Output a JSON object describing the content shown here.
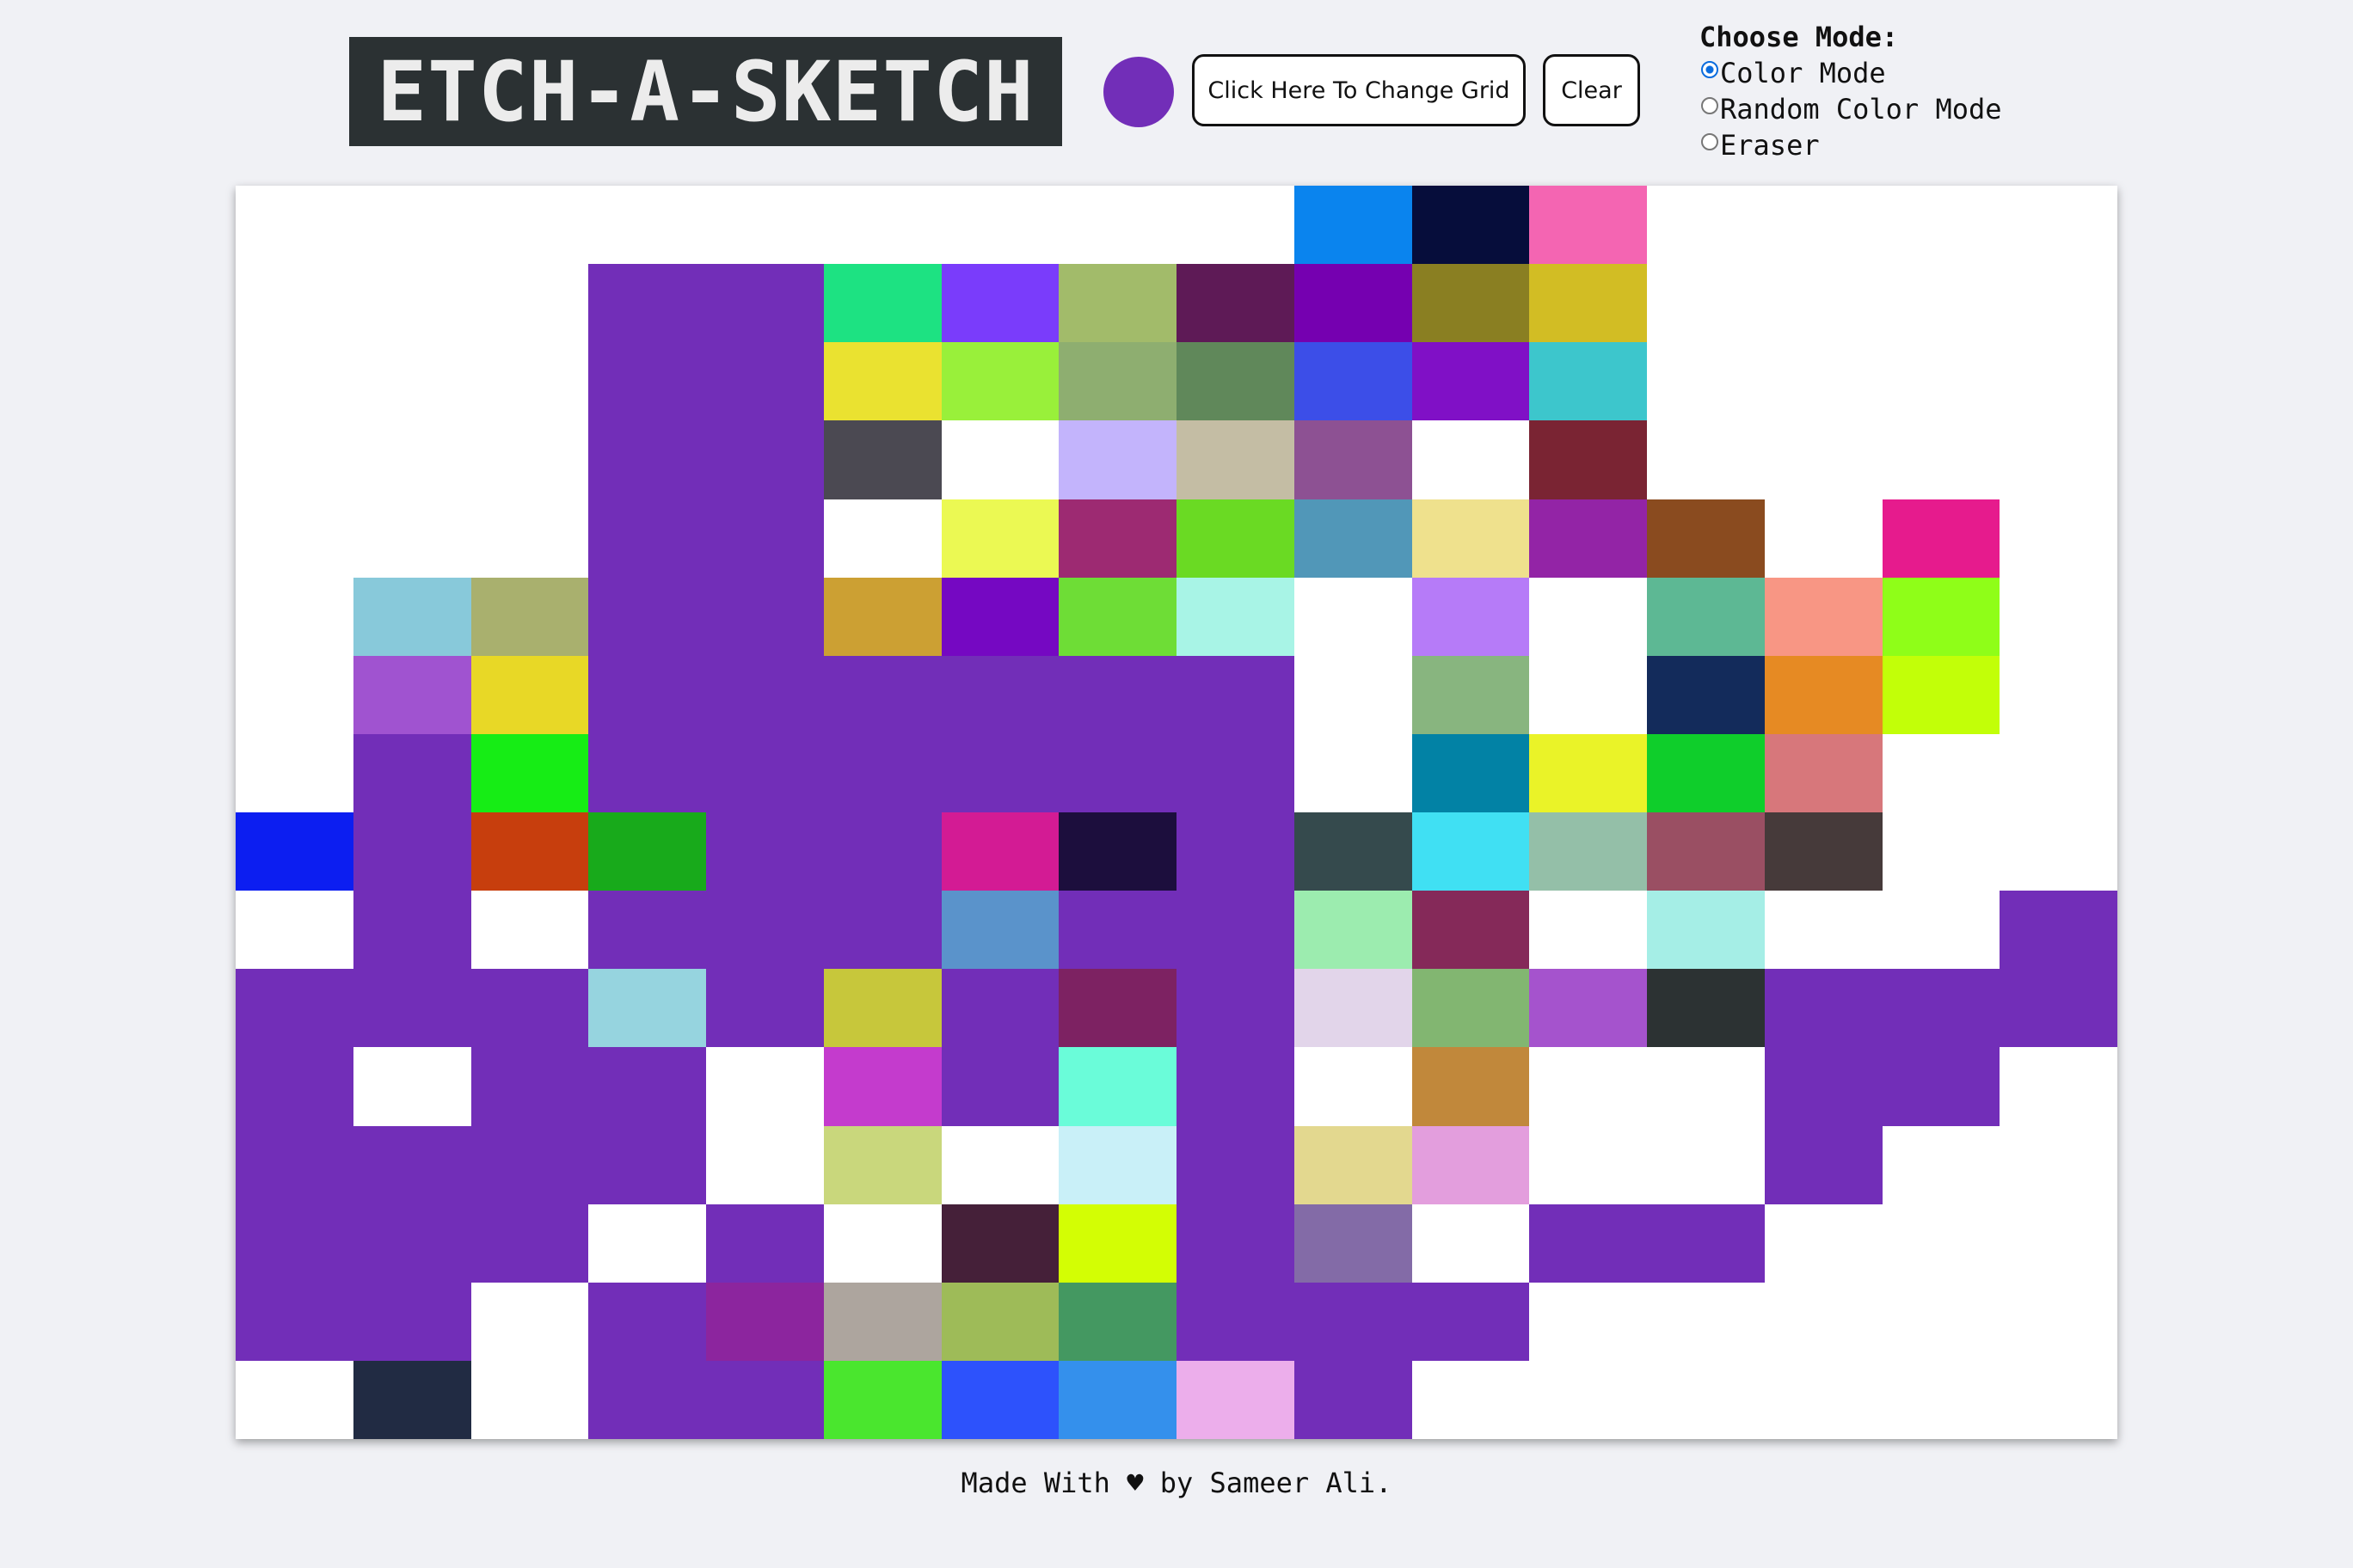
{
  "header": {
    "title": "ETCH-A-SKETCH",
    "color_picker_value": "#722eb8",
    "change_grid_label": "Click Here To Change Grid",
    "clear_label": "Clear"
  },
  "modes": {
    "heading": "Choose Mode:",
    "options": [
      {
        "label": "Color Mode",
        "checked": true
      },
      {
        "label": "Random Color Mode",
        "checked": false
      },
      {
        "label": "Eraser",
        "checked": false
      }
    ]
  },
  "grid": {
    "size": 16,
    "cells": [
      [
        "#ffffff",
        "#ffffff",
        "#ffffff",
        "#ffffff",
        "#ffffff",
        "#ffffff",
        "#ffffff",
        "#ffffff",
        "#ffffff",
        "#0a84ee",
        "#060d3b",
        "#f465b2",
        "#ffffff",
        "#ffffff",
        "#ffffff",
        "#ffffff"
      ],
      [
        "#ffffff",
        "#ffffff",
        "#ffffff",
        "#722eb8",
        "#722eb8",
        "#1de282",
        "#7a3cfb",
        "#a2bb6a",
        "#5e1a56",
        "#7500b0",
        "#8a7f22",
        "#d2bd24",
        "#ffffff",
        "#ffffff",
        "#ffffff",
        "#ffffff"
      ],
      [
        "#ffffff",
        "#ffffff",
        "#ffffff",
        "#722eb8",
        "#722eb8",
        "#eae230",
        "#99f03a",
        "#8eae70",
        "#60885a",
        "#3c4ee8",
        "#8010c6",
        "#3dc6cc",
        "#ffffff",
        "#ffffff",
        "#ffffff",
        "#ffffff"
      ],
      [
        "#ffffff",
        "#ffffff",
        "#ffffff",
        "#722eb8",
        "#722eb8",
        "#4b4952",
        "#ffffff",
        "#c3b4fc",
        "#c4bda4",
        "#8d5193",
        "#ffffff",
        "#7a2433",
        "#ffffff",
        "#ffffff",
        "#ffffff",
        "#ffffff"
      ],
      [
        "#ffffff",
        "#ffffff",
        "#ffffff",
        "#722eb8",
        "#722eb8",
        "#ffffff",
        "#ebf953",
        "#9d2a72",
        "#6ada23",
        "#5197b8",
        "#efe18d",
        "#9324a6",
        "#8a4b1f",
        "#ffffff",
        "#e61b8d",
        "#ffffff"
      ],
      [
        "#ffffff",
        "#88c9da",
        "#a9b06e",
        "#722eb8",
        "#722eb8",
        "#cca033",
        "#7508c2",
        "#6edd36",
        "#a8f4e6",
        "#ffffff",
        "#b67bf8",
        "#ffffff",
        "#5db894",
        "#f89684",
        "#8ffe18",
        "#ffffff"
      ],
      [
        "#ffffff",
        "#a053d0",
        "#e8d826",
        "#722eb8",
        "#722eb8",
        "#722eb8",
        "#722eb8",
        "#722eb8",
        "#722eb8",
        "#ffffff",
        "#88b57f",
        "#ffffff",
        "#132b5b",
        "#e68a23",
        "#c2ff08",
        "#ffffff"
      ],
      [
        "#ffffff",
        "#722eb8",
        "#16ed15",
        "#722eb8",
        "#722eb8",
        "#722eb8",
        "#722eb8",
        "#722eb8",
        "#722eb8",
        "#ffffff",
        "#0282a5",
        "#eaf328",
        "#0fce2b",
        "#d7777b",
        "#ffffff",
        "#ffffff"
      ],
      [
        "#0c1ef1",
        "#722eb8",
        "#c73e0d",
        "#18aa1b",
        "#722eb8",
        "#722eb8",
        "#d31b94",
        "#1c0e3d",
        "#722eb8",
        "#354a4d",
        "#40e0f3",
        "#94bfa8",
        "#9a4f63",
        "#463a3a",
        "#ffffff",
        "#ffffff"
      ],
      [
        "#ffffff",
        "#722eb8",
        "#ffffff",
        "#722eb8",
        "#722eb8",
        "#722eb8",
        "#5a93cb",
        "#722eb8",
        "#722eb8",
        "#9cecaf",
        "#852959",
        "#ffffff",
        "#a5eee6",
        "#ffffff",
        "#ffffff",
        "#722eb8"
      ],
      [
        "#722eb8",
        "#722eb8",
        "#722eb8",
        "#96d4df",
        "#722eb8",
        "#c7c73b",
        "#722eb8",
        "#7d2262",
        "#722eb8",
        "#e2d5ea",
        "#82b671",
        "#a553cd",
        "#2c3233",
        "#722eb8",
        "#722eb8",
        "#722eb8"
      ],
      [
        "#722eb8",
        "#ffffff",
        "#722eb8",
        "#722eb8",
        "#ffffff",
        "#c43bcd",
        "#722eb8",
        "#6afcd9",
        "#722eb8",
        "#ffffff",
        "#c1883b",
        "#ffffff",
        "#ffffff",
        "#722eb8",
        "#722eb8",
        "#ffffff"
      ],
      [
        "#722eb8",
        "#722eb8",
        "#722eb8",
        "#722eb8",
        "#ffffff",
        "#c9d77c",
        "#ffffff",
        "#c9f0f8",
        "#722eb8",
        "#e3d88f",
        "#e39edd",
        "#ffffff",
        "#ffffff",
        "#722eb8",
        "#ffffff",
        "#ffffff"
      ],
      [
        "#722eb8",
        "#722eb8",
        "#722eb8",
        "#ffffff",
        "#722eb8",
        "#ffffff",
        "#452039",
        "#d3fe04",
        "#722eb8",
        "#836ba7",
        "#ffffff",
        "#722eb8",
        "#722eb8",
        "#ffffff",
        "#ffffff",
        "#ffffff"
      ],
      [
        "#722eb8",
        "#722eb8",
        "#ffffff",
        "#722eb8",
        "#8c259e",
        "#ada59e",
        "#9ebb58",
        "#449861",
        "#722eb8",
        "#722eb8",
        "#722eb8",
        "#ffffff",
        "#ffffff",
        "#ffffff",
        "#ffffff",
        "#ffffff"
      ],
      [
        "#ffffff",
        "#212b43",
        "#ffffff",
        "#722eb8",
        "#722eb8",
        "#4ae62e",
        "#2d52fc",
        "#3490ec",
        "#ecaeeb",
        "#722eb8",
        "#ffffff",
        "#ffffff",
        "#ffffff",
        "#ffffff",
        "#ffffff",
        "#ffffff"
      ]
    ]
  },
  "footer": {
    "text": "Made With ♥ by Sameer Ali."
  }
}
